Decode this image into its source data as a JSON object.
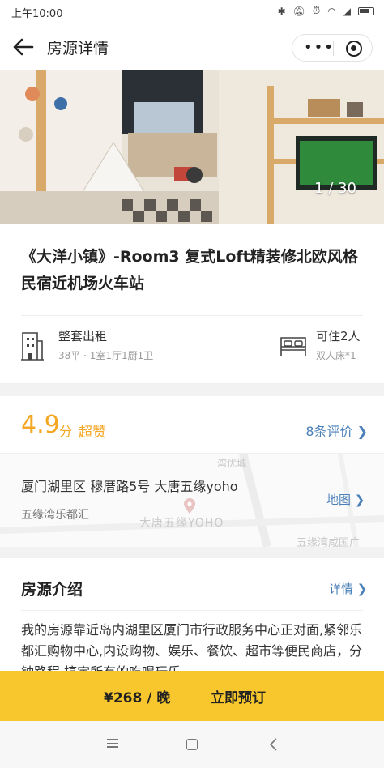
{
  "status_bar": {
    "time": "上午10:00",
    "icons": [
      "bluetooth-icon",
      "mute-icon",
      "alarm-icon",
      "wifi-icon",
      "signal-icon",
      "battery-icon"
    ]
  },
  "nav": {
    "title": "房源详情",
    "capsule_dots": "•••"
  },
  "gallery": {
    "counter": "1 / 30"
  },
  "listing": {
    "title": "《大洋小镇》-Room3 复式Loft精装修北欧风格民宿近机场火车站",
    "rent_type": "整套出租",
    "rent_detail": "38平 · 1室1厅1厨1卫",
    "capacity": "可住2人",
    "bed_detail": "双人床*1"
  },
  "rating": {
    "score": "4.9",
    "unit": "分",
    "word": "超赞",
    "reviews_link": "8条评价 ❯"
  },
  "location": {
    "address": "厦门湖里区 穆厝路5号 大唐五缘yoho",
    "landmark": "五缘湾乐都汇",
    "map_link": "地图 ❯",
    "map_label_main": "大唐五缘YOHO",
    "map_label_bottom": "五缘湾咸国广",
    "map_label_top": "湾优城"
  },
  "intro": {
    "title": "房源介绍",
    "more_link": "详情 ❯",
    "body": "我的房源靠近岛内湖里区厦门市行政服务中心正对面,紧邻乐都汇购物中心,内设购物、娱乐、餐饮、超市等便民商店，分钟路程 搞定所有的吃喝玩乐"
  },
  "booking": {
    "price": "¥268 / 晚",
    "book_label": "立即预订"
  },
  "colors": {
    "accent": "#f5a623",
    "link": "#4a7fb8",
    "cta": "#f7c72d"
  }
}
